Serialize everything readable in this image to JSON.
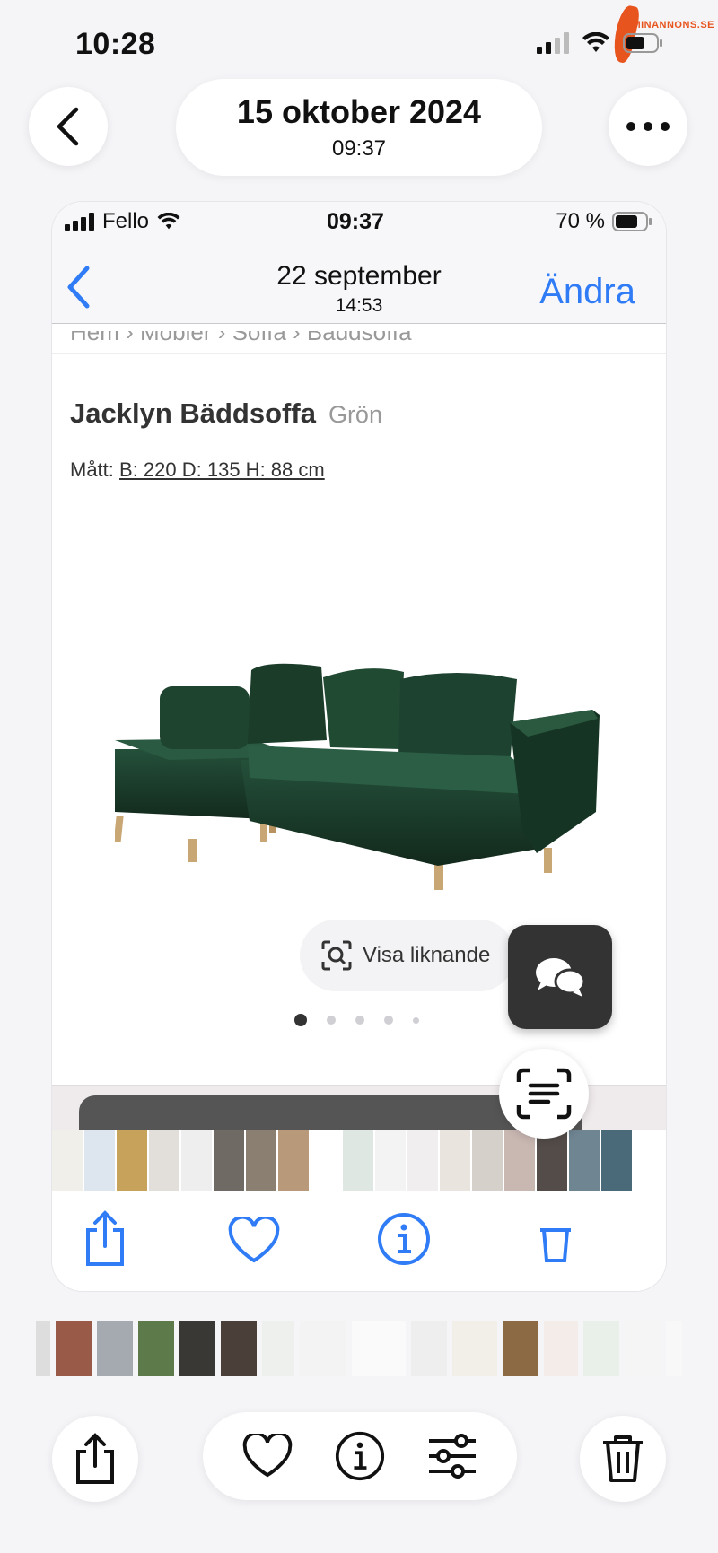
{
  "status": {
    "time": "10:28"
  },
  "watermark": {
    "text": "MINANNONS.SE"
  },
  "header": {
    "date": "15 oktober 2024",
    "time": "09:37"
  },
  "inner": {
    "status": {
      "carrier": "Fello",
      "time": "09:37",
      "battery": "70 %"
    },
    "nav": {
      "title": "22 september",
      "subtitle": "14:53",
      "edit": "Ändra"
    },
    "breadcrumb": "Hem  ›  Möbler  ›  Soffa  ›  Bäddsoffa",
    "product": {
      "name": "Jacklyn Bäddsoffa",
      "color": "Grön",
      "dims_prefix": "Mått:",
      "dims_value": "B: 220 D: 135 H: 88 cm"
    },
    "visual_search": "Visa liknande",
    "carousel": {
      "count": 5,
      "active": 1
    }
  },
  "colors": {
    "accent": "#2f7cf6",
    "sofa": "#1f3a2a",
    "watermark": "#e8541e"
  },
  "icons": {
    "back": "chevron-left-icon",
    "more": "ellipsis-icon",
    "share": "share-icon",
    "heart": "heart-icon",
    "info": "info-icon",
    "adjust": "sliders-icon",
    "trash": "trash-icon",
    "chat": "chat-icon",
    "lens": "visual-lookup-icon"
  }
}
